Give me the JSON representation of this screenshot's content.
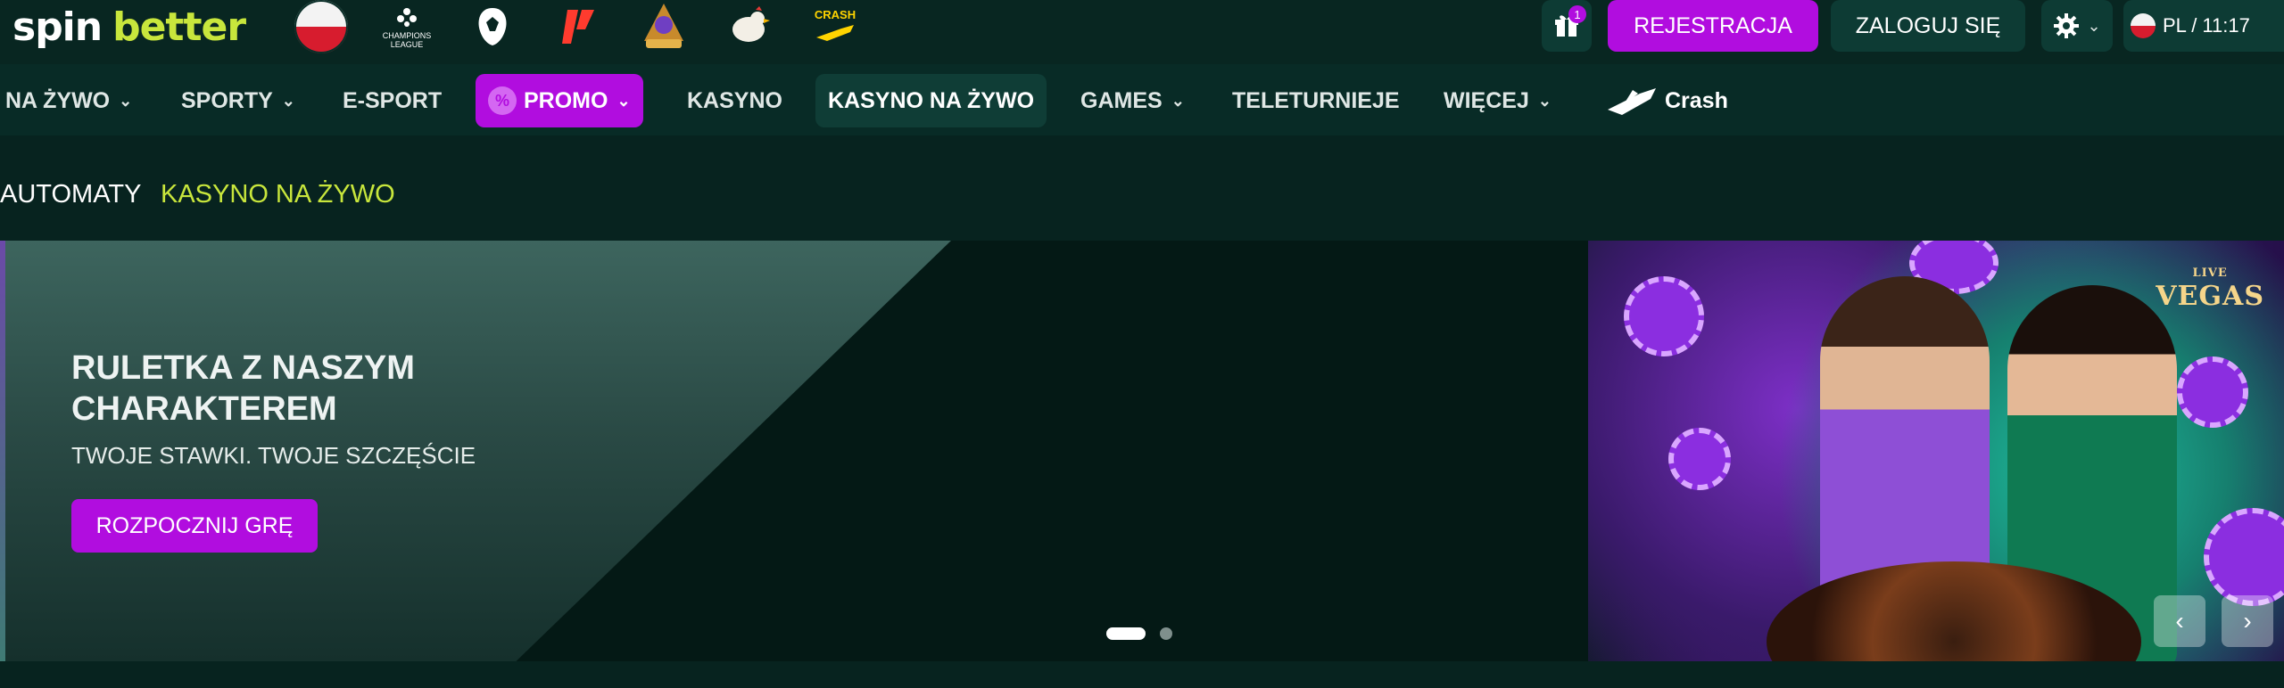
{
  "logo": {
    "part1": "spin",
    "part2": "better"
  },
  "promo_icons": [
    {
      "icon": "poland-flag-icon"
    },
    {
      "icon": "champions-league-icon",
      "label": "CHAMPIONS LEAGUE"
    },
    {
      "icon": "premier-league-lion-icon"
    },
    {
      "icon": "laliga-icon"
    },
    {
      "icon": "olympus-icon"
    },
    {
      "icon": "chicken-icon"
    },
    {
      "icon": "crash-plane-icon",
      "label": "CRASH"
    }
  ],
  "header": {
    "gift_count": "1",
    "register_label": "REJESTRACJA",
    "login_label": "ZALOGUJ SIĘ",
    "lang_time": "PL / 11:17"
  },
  "nav": {
    "items": [
      {
        "label": "NA ŻYWO",
        "dropdown": true
      },
      {
        "label": "SPORTY",
        "dropdown": true
      },
      {
        "label": "E-SPORT",
        "dropdown": false
      },
      {
        "label": "PROMO",
        "dropdown": true
      },
      {
        "label": "KASYNO",
        "dropdown": false
      },
      {
        "label": "KASYNO NA ŻYWO",
        "dropdown": false
      },
      {
        "label": "GAMES",
        "dropdown": true
      },
      {
        "label": "TELETURNIEJE",
        "dropdown": false
      },
      {
        "label": "WIĘCEJ",
        "dropdown": true
      },
      {
        "label": "Crash",
        "dropdown": false
      }
    ]
  },
  "subnav": {
    "items": [
      {
        "label": "AUTOMATY"
      },
      {
        "label": "KASYNO NA ŻYWO"
      }
    ]
  },
  "banner": {
    "title": "RULETKA Z NASZYM CHARAKTEREM",
    "subtitle": "TWOJE STAWKI. TWOJE SZCZĘŚCIE",
    "cta": "ROZPOCZNIJ GRĘ",
    "brand_small": "LIVE",
    "brand": "VEGAS",
    "prev_icon": "‹",
    "next_icon": "›",
    "slides": 2,
    "active_slide": 1
  },
  "colors": {
    "accent_purple": "#b10ddf",
    "accent_green": "#c8e63c",
    "bg_dark": "#07231f"
  }
}
